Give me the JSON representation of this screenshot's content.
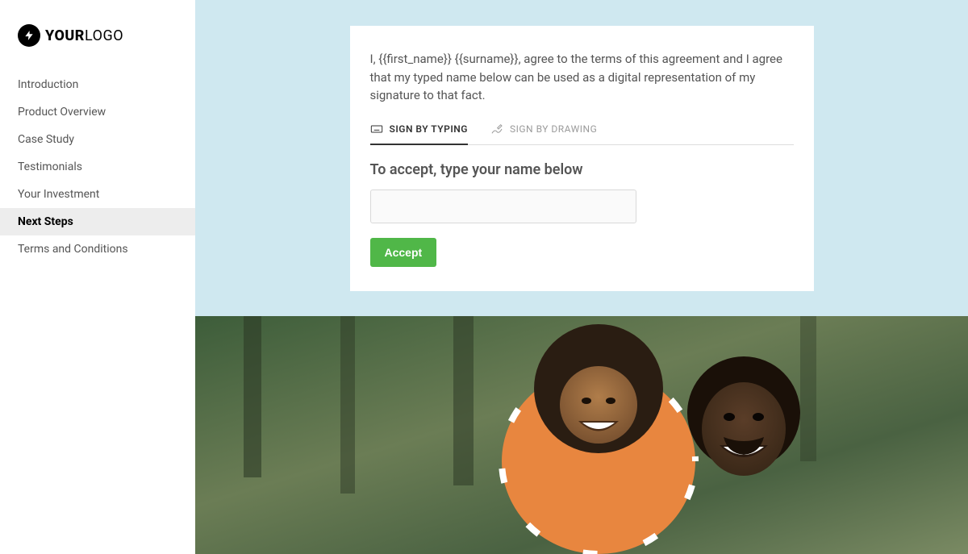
{
  "logo": {
    "bold": "YOUR",
    "light": "LOGO"
  },
  "nav": [
    {
      "label": "Introduction",
      "active": false
    },
    {
      "label": "Product Overview",
      "active": false
    },
    {
      "label": "Case Study",
      "active": false
    },
    {
      "label": "Testimonials",
      "active": false
    },
    {
      "label": "Your Investment",
      "active": false
    },
    {
      "label": "Next Steps",
      "active": true
    },
    {
      "label": "Terms and Conditions",
      "active": false
    }
  ],
  "signature": {
    "agreement_text": "I, {{first_name}} {{surname}}, agree to the terms of this agreement and I agree that my typed name below can be used as a digital representation of my signature to that fact.",
    "tabs": {
      "typing": "SIGN BY TYPING",
      "drawing": "SIGN BY DRAWING"
    },
    "prompt": "To accept, type your name below",
    "input_value": "",
    "accept_label": "Accept"
  }
}
